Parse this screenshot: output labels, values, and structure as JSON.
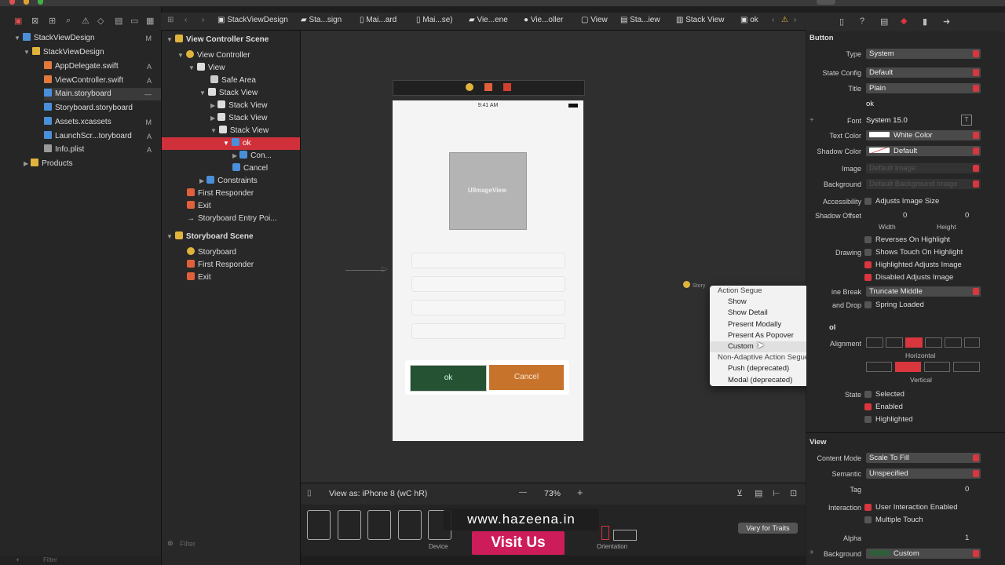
{
  "navigator": {
    "items": [
      {
        "label": "StackViewDesign",
        "badge": "M"
      },
      {
        "label": "StackViewDesign",
        "badge": ""
      },
      {
        "label": "AppDelegate.swift",
        "badge": "A"
      },
      {
        "label": "ViewController.swift",
        "badge": "A"
      },
      {
        "label": "Main.storyboard",
        "badge": "—"
      },
      {
        "label": "Storyboard.storyboard",
        "badge": ""
      },
      {
        "label": "Assets.xcassets",
        "badge": "M"
      },
      {
        "label": "LaunchScr...toryboard",
        "badge": "A"
      },
      {
        "label": "Info.plist",
        "badge": "A"
      },
      {
        "label": "Products",
        "badge": ""
      }
    ],
    "filter_placeholder": "Filter"
  },
  "breadcrumb": [
    "StackViewDesign",
    "Sta...sign",
    "Mai...ard",
    "Mai...se)",
    "Vie...ene",
    "Vie...oller",
    "View",
    "Sta...iew",
    "Stack View",
    "ok"
  ],
  "outline": {
    "items": [
      {
        "label": "View Controller Scene"
      },
      {
        "label": "View Controller"
      },
      {
        "label": "View"
      },
      {
        "label": "Safe Area"
      },
      {
        "label": "Stack View"
      },
      {
        "label": "Stack View"
      },
      {
        "label": "Stack View"
      },
      {
        "label": "Stack View"
      },
      {
        "label": "ok"
      },
      {
        "label": "Con..."
      },
      {
        "label": "Cancel"
      },
      {
        "label": "Constraints"
      },
      {
        "label": "First Responder"
      },
      {
        "label": "Exit"
      },
      {
        "label": "Storyboard Entry Poi..."
      },
      {
        "label": "Storyboard Scene"
      },
      {
        "label": "Storyboard"
      },
      {
        "label": "First Responder"
      },
      {
        "label": "Exit"
      }
    ],
    "filter_placeholder": "Filter"
  },
  "canvas": {
    "status_time": "9:41 AM",
    "imageview_label": "UIImageView",
    "ok_label": "ok",
    "cancel_label": "Cancel",
    "story_chip": "Story"
  },
  "segue_menu": {
    "items": [
      {
        "label": "Action Segue",
        "kind": "header"
      },
      {
        "label": "Show",
        "kind": "option"
      },
      {
        "label": "Show Detail",
        "kind": "option"
      },
      {
        "label": "Present Modally",
        "kind": "option"
      },
      {
        "label": "Present As Popover",
        "kind": "option"
      },
      {
        "label": "Custom",
        "kind": "option"
      },
      {
        "label": "Non-Adaptive Action Segue",
        "kind": "header"
      },
      {
        "label": "Push (deprecated)",
        "kind": "option"
      },
      {
        "label": "Modal (deprecated)",
        "kind": "option"
      }
    ]
  },
  "bottom": {
    "view_as": "View as: iPhone 8 (wC hR)",
    "zoom_minus": "—",
    "zoom": "73%",
    "zoom_plus": "+",
    "device_label": "Device",
    "orientation_label": "Orientation",
    "vary_button": "Vary for Traits"
  },
  "watermark": {
    "site": "www.hazeena.in",
    "cta": "Visit Us"
  },
  "inspector": {
    "button_section": "Button",
    "type_label": "Type",
    "type_value": "System",
    "state_config_label": "State Config",
    "state_config_value": "Default",
    "title_label": "Title",
    "title_value": "Plain",
    "title_text": "ok",
    "font_label": "Font",
    "font_value": "System 15.0",
    "text_color_label": "Text Color",
    "text_color_value": "White Color",
    "shadow_color_label": "Shadow Color",
    "shadow_color_value": "Default",
    "image_label": "Image",
    "image_placeholder": "Default Image",
    "background_label": "Background",
    "background_placeholder": "Default Background Image",
    "accessibility_label": "Accessibility",
    "adjusts_image_size": "Adjusts Image Size",
    "shadow_offset_label": "Shadow Offset",
    "shadow_w": "0",
    "shadow_h": "0",
    "width_label": "Width",
    "height_label": "Height",
    "reverses_label": "Reverses On Highlight",
    "drawing_label": "Drawing",
    "shows_touch_label": "Shows Touch On Highlight",
    "highlighted_adjusts_label": "Highlighted Adjusts Image",
    "disabled_adjusts_label": "Disabled Adjusts Image",
    "line_break_label": "ine Break",
    "line_break_value": "Truncate Middle",
    "drag_drop_label": "and Drop",
    "spring_loaded_label": "Spring Loaded",
    "control_section": "ol",
    "alignment_label": "Alignment",
    "horizontal_label": "Horizontal",
    "vertical_label": "Vertical",
    "state_label": "State",
    "selected_label": "Selected",
    "enabled_label": "Enabled",
    "highlighted_label": "Highlighted",
    "view_section": "View",
    "content_mode_label": "Content Mode",
    "content_mode_value": "Scale To Fill",
    "semantic_label": "Semantic",
    "semantic_value": "Unspecified",
    "tag_label": "Tag",
    "tag_value": "0",
    "interaction_label": "Interaction",
    "user_interaction_label": "User Interaction Enabled",
    "multiple_touch_label": "Multiple Touch",
    "alpha_label": "Alpha",
    "alpha_value": "1",
    "bg_label": "Background",
    "bg_value": "Custom"
  },
  "colors": {
    "accent": "#d9363e",
    "ok_button": "#245232",
    "cancel_button": "#c8732c",
    "visit_button": "#cc1d5a"
  }
}
